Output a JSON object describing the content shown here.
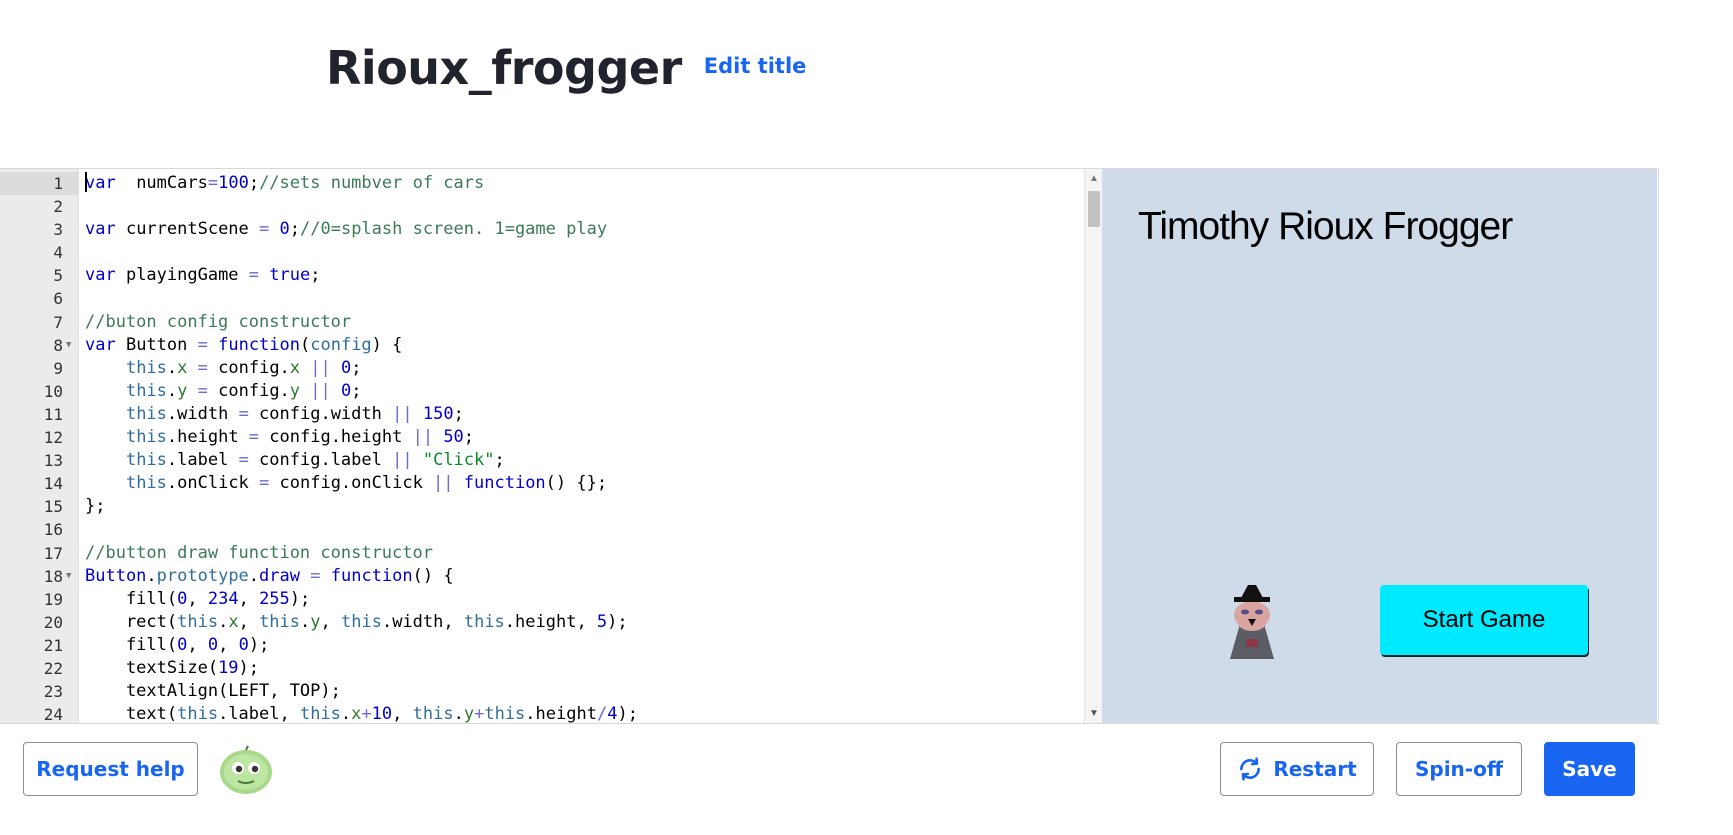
{
  "page": {
    "title": "Rioux_frogger",
    "edit_title_label": "Edit title"
  },
  "editor": {
    "cursor_line": 1,
    "lines": [
      {
        "n": "1",
        "fold": false,
        "tokens": [
          [
            "kw",
            "var"
          ],
          [
            "",
            "  numCars"
          ],
          [
            "op",
            "="
          ],
          [
            "num",
            "100"
          ],
          [
            "",
            ";"
          ],
          [
            "cm",
            "//sets numbver of cars"
          ]
        ]
      },
      {
        "n": "2",
        "fold": false,
        "tokens": []
      },
      {
        "n": "3",
        "fold": false,
        "tokens": [
          [
            "kw",
            "var"
          ],
          [
            "",
            " currentScene "
          ],
          [
            "op",
            "="
          ],
          [
            "",
            " "
          ],
          [
            "num",
            "0"
          ],
          [
            "",
            ";"
          ],
          [
            "cm",
            "//0=splash screen. 1=game play"
          ]
        ]
      },
      {
        "n": "4",
        "fold": false,
        "tokens": []
      },
      {
        "n": "5",
        "fold": false,
        "tokens": [
          [
            "kw",
            "var"
          ],
          [
            "",
            " playingGame "
          ],
          [
            "op",
            "="
          ],
          [
            "",
            " "
          ],
          [
            "kw",
            "true"
          ],
          [
            "",
            ";"
          ]
        ]
      },
      {
        "n": "6",
        "fold": false,
        "tokens": []
      },
      {
        "n": "7",
        "fold": false,
        "tokens": [
          [
            "cm",
            "//buton config constructor"
          ]
        ]
      },
      {
        "n": "8",
        "fold": true,
        "tokens": [
          [
            "kw",
            "var"
          ],
          [
            "",
            " Button "
          ],
          [
            "op",
            "="
          ],
          [
            "",
            " "
          ],
          [
            "kw",
            "function"
          ],
          [
            "",
            "("
          ],
          [
            "par",
            "config"
          ],
          [
            "",
            ") {"
          ]
        ]
      },
      {
        "n": "9",
        "fold": false,
        "tokens": [
          [
            "",
            "    "
          ],
          [
            "th",
            "this"
          ],
          [
            "",
            "."
          ],
          [
            "pr",
            "x"
          ],
          [
            "",
            " "
          ],
          [
            "op",
            "="
          ],
          [
            "",
            " config."
          ],
          [
            "pr",
            "x"
          ],
          [
            "",
            " "
          ],
          [
            "op",
            "||"
          ],
          [
            "",
            " "
          ],
          [
            "num",
            "0"
          ],
          [
            "",
            ";"
          ]
        ]
      },
      {
        "n": "10",
        "fold": false,
        "tokens": [
          [
            "",
            "    "
          ],
          [
            "th",
            "this"
          ],
          [
            "",
            "."
          ],
          [
            "pr",
            "y"
          ],
          [
            "",
            " "
          ],
          [
            "op",
            "="
          ],
          [
            "",
            " config."
          ],
          [
            "pr",
            "y"
          ],
          [
            "",
            " "
          ],
          [
            "op",
            "||"
          ],
          [
            "",
            " "
          ],
          [
            "num",
            "0"
          ],
          [
            "",
            ";"
          ]
        ]
      },
      {
        "n": "11",
        "fold": false,
        "tokens": [
          [
            "",
            "    "
          ],
          [
            "th",
            "this"
          ],
          [
            "",
            ".width "
          ],
          [
            "op",
            "="
          ],
          [
            "",
            " config.width "
          ],
          [
            "op",
            "||"
          ],
          [
            "",
            " "
          ],
          [
            "num",
            "150"
          ],
          [
            "",
            ";"
          ]
        ]
      },
      {
        "n": "12",
        "fold": false,
        "tokens": [
          [
            "",
            "    "
          ],
          [
            "th",
            "this"
          ],
          [
            "",
            ".height "
          ],
          [
            "op",
            "="
          ],
          [
            "",
            " config.height "
          ],
          [
            "op",
            "||"
          ],
          [
            "",
            " "
          ],
          [
            "num",
            "50"
          ],
          [
            "",
            ";"
          ]
        ]
      },
      {
        "n": "13",
        "fold": false,
        "tokens": [
          [
            "",
            "    "
          ],
          [
            "th",
            "this"
          ],
          [
            "",
            ".label "
          ],
          [
            "op",
            "="
          ],
          [
            "",
            " config.label "
          ],
          [
            "op",
            "||"
          ],
          [
            "",
            " "
          ],
          [
            "str",
            "\"Click\""
          ],
          [
            "",
            ";"
          ]
        ]
      },
      {
        "n": "14",
        "fold": false,
        "tokens": [
          [
            "",
            "    "
          ],
          [
            "th",
            "this"
          ],
          [
            "",
            ".onClick "
          ],
          [
            "op",
            "="
          ],
          [
            "",
            " config.onClick "
          ],
          [
            "op",
            "||"
          ],
          [
            "",
            " "
          ],
          [
            "kw",
            "function"
          ],
          [
            "",
            "() {};"
          ]
        ]
      },
      {
        "n": "15",
        "fold": false,
        "tokens": [
          [
            "",
            "};"
          ]
        ]
      },
      {
        "n": "16",
        "fold": false,
        "tokens": []
      },
      {
        "n": "17",
        "fold": false,
        "tokens": [
          [
            "cm",
            "//button draw function constructor"
          ]
        ]
      },
      {
        "n": "18",
        "fold": true,
        "tokens": [
          [
            "kw",
            "Button"
          ],
          [
            "",
            "."
          ],
          [
            "th",
            "prototype"
          ],
          [
            "",
            "."
          ],
          [
            "kw",
            "draw"
          ],
          [
            "",
            " "
          ],
          [
            "op",
            "="
          ],
          [
            "",
            " "
          ],
          [
            "kw",
            "function"
          ],
          [
            "",
            "() {"
          ]
        ]
      },
      {
        "n": "19",
        "fold": false,
        "tokens": [
          [
            "",
            "    fill("
          ],
          [
            "num",
            "0"
          ],
          [
            "",
            ", "
          ],
          [
            "num",
            "234"
          ],
          [
            "",
            ", "
          ],
          [
            "num",
            "255"
          ],
          [
            "",
            ");"
          ]
        ]
      },
      {
        "n": "20",
        "fold": false,
        "tokens": [
          [
            "",
            "    rect("
          ],
          [
            "th",
            "this"
          ],
          [
            "",
            "."
          ],
          [
            "pr",
            "x"
          ],
          [
            "",
            ", "
          ],
          [
            "th",
            "this"
          ],
          [
            "",
            "."
          ],
          [
            "pr",
            "y"
          ],
          [
            "",
            ", "
          ],
          [
            "th",
            "this"
          ],
          [
            "",
            ".width, "
          ],
          [
            "th",
            "this"
          ],
          [
            "",
            ".height, "
          ],
          [
            "num",
            "5"
          ],
          [
            "",
            ");"
          ]
        ]
      },
      {
        "n": "21",
        "fold": false,
        "tokens": [
          [
            "",
            "    fill("
          ],
          [
            "num",
            "0"
          ],
          [
            "",
            ", "
          ],
          [
            "num",
            "0"
          ],
          [
            "",
            ", "
          ],
          [
            "num",
            "0"
          ],
          [
            "",
            ");"
          ]
        ]
      },
      {
        "n": "22",
        "fold": false,
        "tokens": [
          [
            "",
            "    textSize("
          ],
          [
            "num",
            "19"
          ],
          [
            "",
            ");"
          ]
        ]
      },
      {
        "n": "23",
        "fold": false,
        "tokens": [
          [
            "",
            "    textAlign(LEFT, TOP);"
          ]
        ]
      },
      {
        "n": "24",
        "fold": false,
        "tokens": [
          [
            "",
            "    text("
          ],
          [
            "th",
            "this"
          ],
          [
            "",
            ".label, "
          ],
          [
            "th",
            "this"
          ],
          [
            "",
            "."
          ],
          [
            "pr",
            "x"
          ],
          [
            "op",
            "+"
          ],
          [
            "num",
            "10"
          ],
          [
            "",
            ", "
          ],
          [
            "th",
            "this"
          ],
          [
            "",
            "."
          ],
          [
            "pr",
            "y"
          ],
          [
            "op",
            "+"
          ],
          [
            "th",
            "this"
          ],
          [
            "",
            ".height"
          ],
          [
            "op",
            "/"
          ],
          [
            "num",
            "4"
          ],
          [
            "",
            ");"
          ]
        ]
      }
    ]
  },
  "canvas": {
    "title": "Timothy Rioux Frogger",
    "start_button_label": "Start Game",
    "background": "#cfdbe8",
    "button_color": "#00eaff"
  },
  "toolbar": {
    "help_label": "Request help",
    "restart_label": "Restart",
    "spinoff_label": "Spin-off",
    "save_label": "Save",
    "accent": "#1865f2"
  }
}
